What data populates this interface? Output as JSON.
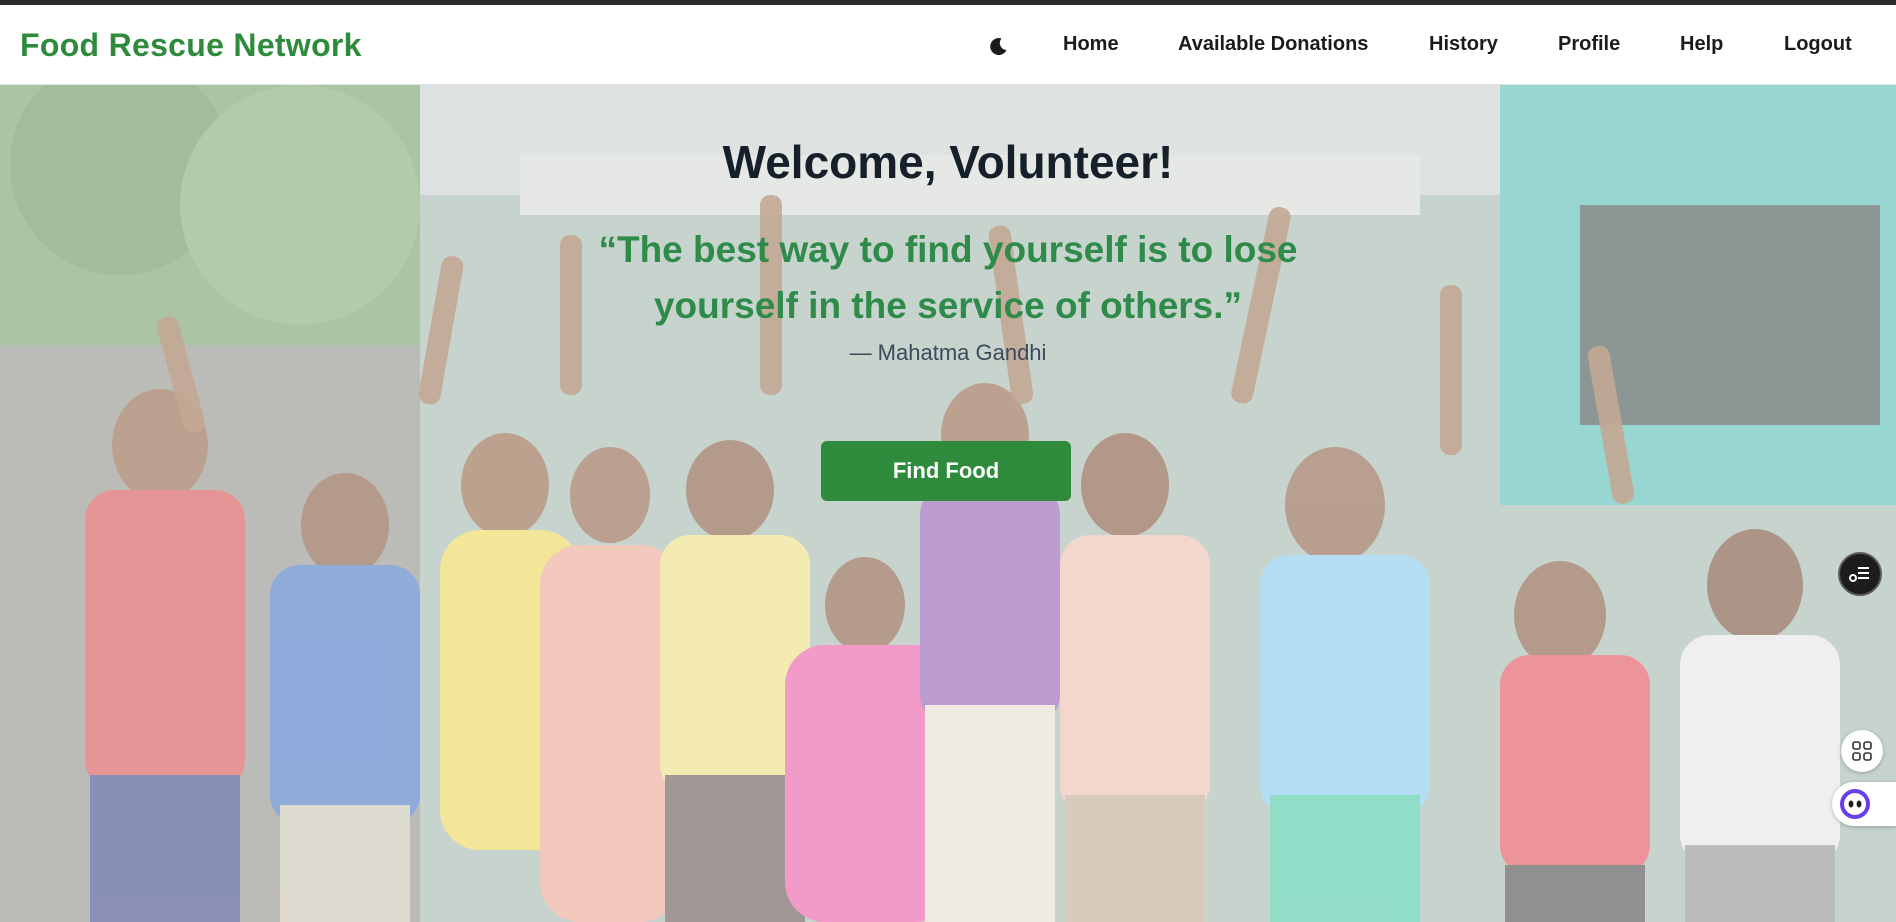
{
  "navbar": {
    "brand": "Food Rescue Network",
    "theme_toggle_icon": "moon-icon",
    "links": [
      {
        "label": "Home"
      },
      {
        "label": "Available Donations"
      },
      {
        "label": "History"
      },
      {
        "label": "Profile"
      },
      {
        "label": "Help"
      },
      {
        "label": "Logout"
      }
    ]
  },
  "hero": {
    "background": "photo of smiling children raising hands",
    "welcome": "Welcome, Volunteer!",
    "quote": "“The best way to find yourself is to lose yourself in the service of others.”",
    "author": "— Mahatma Gandhi",
    "cta_label": "Find Food"
  },
  "side_widgets": [
    {
      "icon": "toggle-panel-icon"
    },
    {
      "icon": "apps-grid-icon"
    },
    {
      "icon": "assistant-face-icon"
    }
  ],
  "colors": {
    "brand": "#2e8b3c",
    "quote": "#2e8b4a",
    "heading": "#15202b"
  }
}
